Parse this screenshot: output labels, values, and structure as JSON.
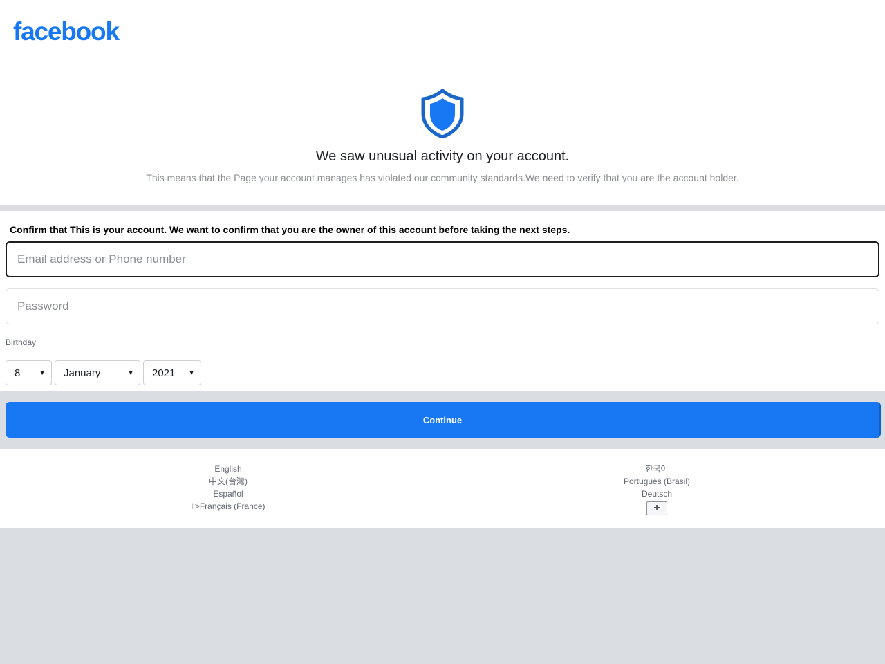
{
  "header": {
    "logo_text": "facebook",
    "brand_color": "#1877f2"
  },
  "alert": {
    "icon": "shield-icon",
    "headline": "We saw unusual activity on your account.",
    "subtext": "This means that the Page your account manages has violated our community standards.We need to verify that you are the account holder."
  },
  "form": {
    "confirm_text": "Confirm that This is your account. We want to confirm that you are the owner of this account before taking the next steps.",
    "email_placeholder": "Email address or Phone number",
    "email_value": "",
    "password_placeholder": "Password",
    "password_value": "",
    "birthday_label": "Birthday",
    "birthday": {
      "day": "8",
      "month": "January",
      "year": "2021"
    },
    "continue_label": "Continue"
  },
  "footer": {
    "languages_left": [
      "English",
      "中文(台灣)",
      "Español",
      "li>Français (France)"
    ],
    "languages_right": [
      "한국어",
      "Português (Brasil)",
      "Deutsch"
    ],
    "more_label": "+"
  }
}
